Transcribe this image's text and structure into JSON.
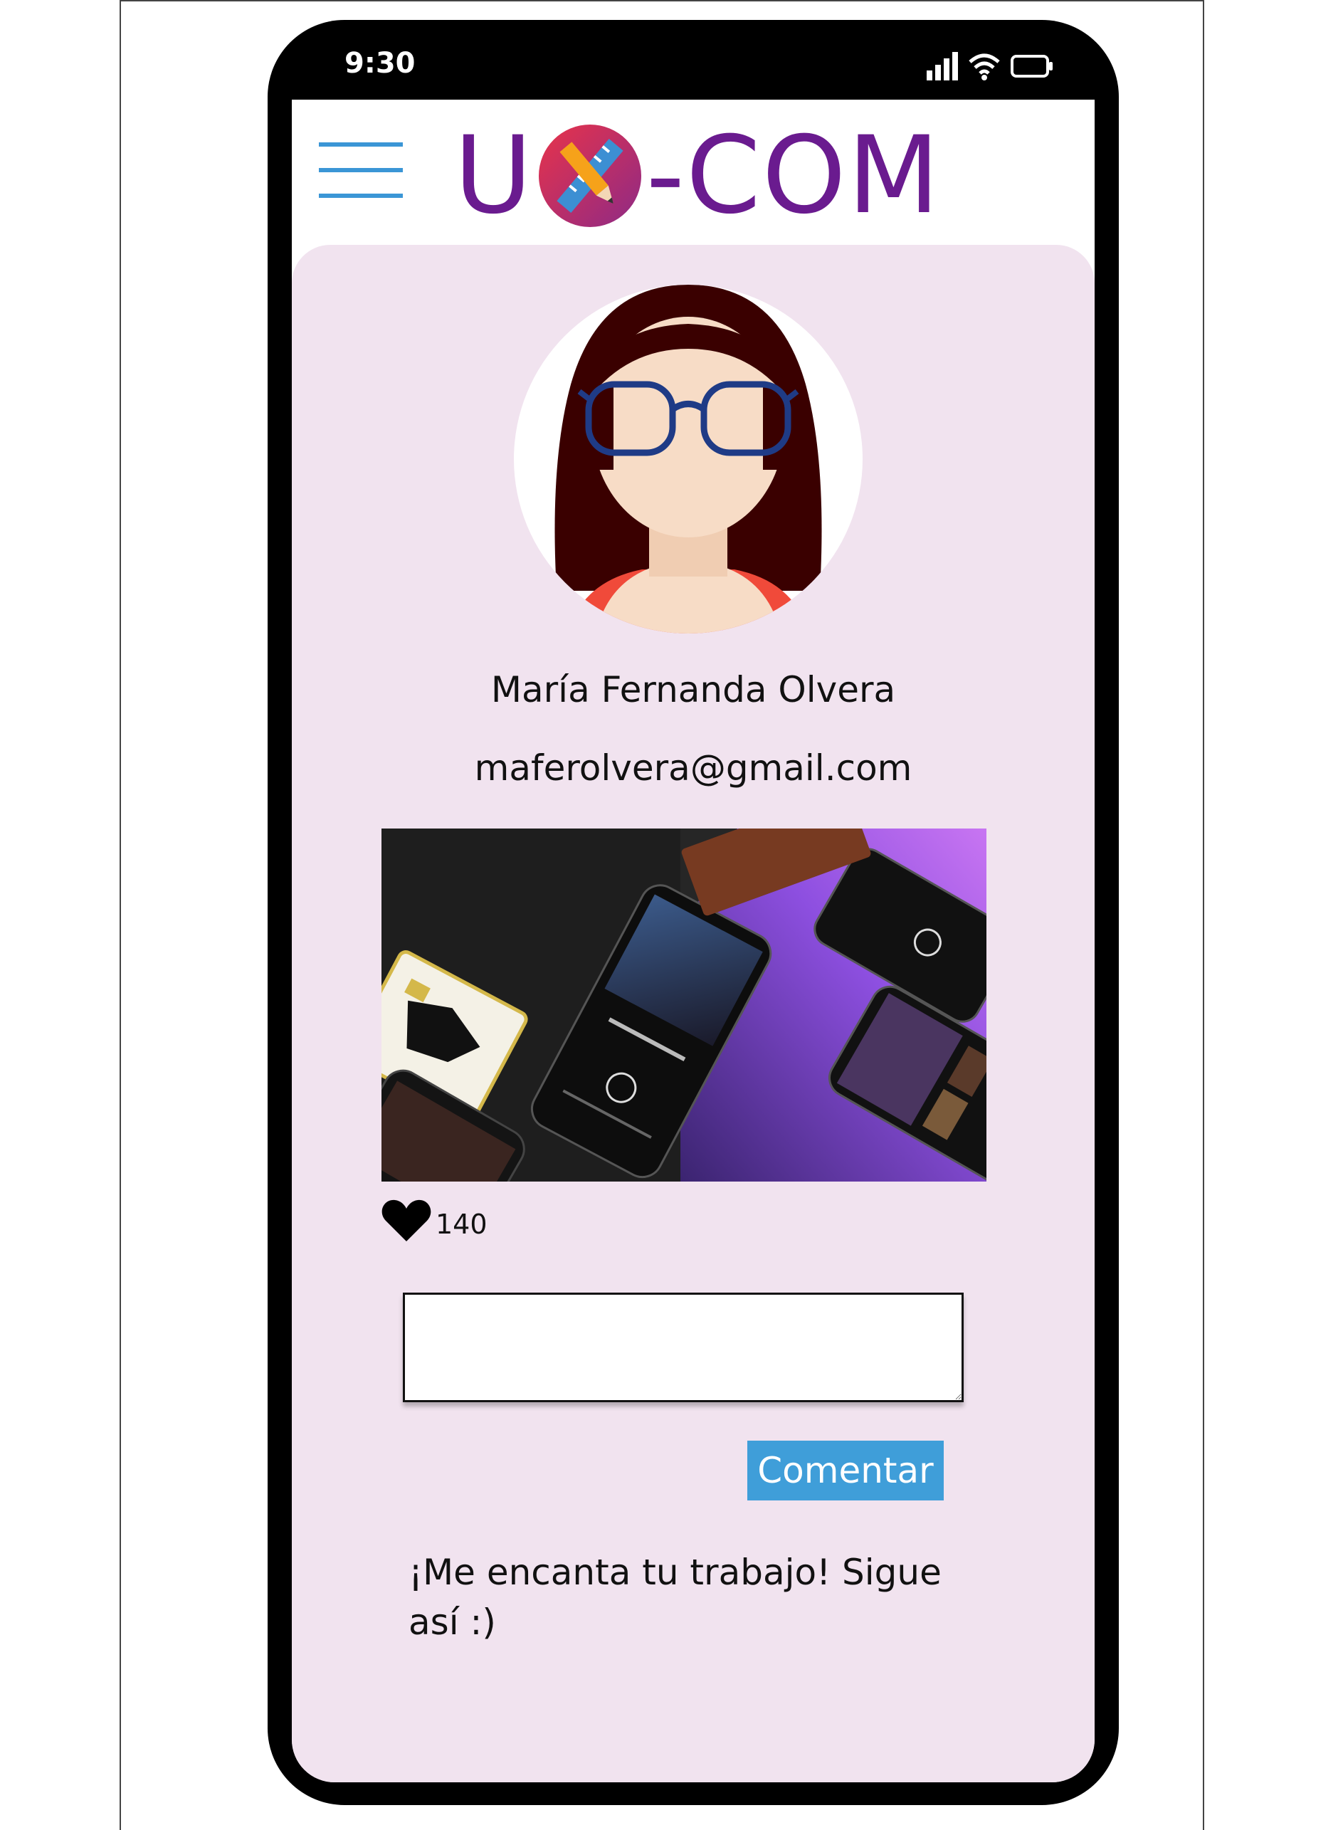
{
  "statusbar": {
    "time": "9:30"
  },
  "app": {
    "logo_left": "U",
    "logo_right": "-COM"
  },
  "profile": {
    "name": "María Fernanda Olvera",
    "email": "maferolvera@gmail.com"
  },
  "post": {
    "likes": "140",
    "comment_input": {
      "value": "",
      "placeholder": ""
    },
    "comment_button_label": "Comentar",
    "comments": [
      "¡Me encanta tu trabajo! Sigue así :)"
    ]
  },
  "colors": {
    "menu_accent": "#3b96d6",
    "logo": "#6a1b8f",
    "card_background": "#f1e3ef",
    "button": "#3f9ed9"
  },
  "icons": [
    "menu-icon",
    "signal-icon",
    "wifi-icon",
    "battery-icon",
    "heart-icon"
  ]
}
